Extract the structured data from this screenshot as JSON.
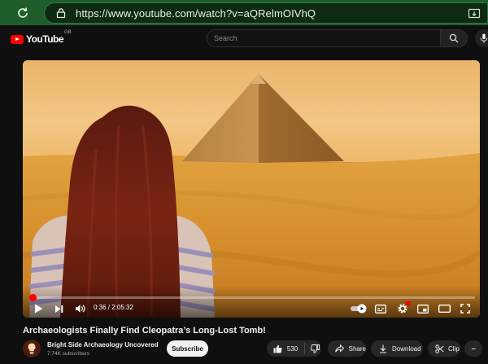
{
  "browser": {
    "url": "https://www.youtube.com/watch?v=aQRelmOIVhQ",
    "icons": [
      "reload-icon",
      "site-info-icon",
      "install-app-icon"
    ]
  },
  "header": {
    "logo_text": "YouTube",
    "country_code": "GB",
    "search_placeholder": "Search",
    "icons": [
      "search-icon",
      "microphone-icon"
    ]
  },
  "player": {
    "time_display": "0:36 / 2:05:32",
    "progress_fraction": 0.0048,
    "icons": [
      "play-icon",
      "next-icon",
      "volume-icon",
      "autoplay-toggle-icon",
      "subtitles-icon",
      "settings-icon",
      "miniplayer-icon",
      "theater-icon",
      "fullscreen-icon"
    ],
    "settings_badge": "HD"
  },
  "video": {
    "title": "Archaeologists Finally Find Cleopatra’s Long-Lost Tomb!",
    "channel": "Bright Side Archaeology Uncovered",
    "subscribers": "7.74K subscribers",
    "subscribe_label": "Subscribe",
    "likes": "530",
    "share_label": "Share",
    "download_label": "Download",
    "clip_label": "Clip",
    "more_label": "···"
  },
  "colors": {
    "browser_bar": "#1f5e2a",
    "background": "#0f0f0f",
    "accent": "#ff0000",
    "pill": "#272727"
  }
}
